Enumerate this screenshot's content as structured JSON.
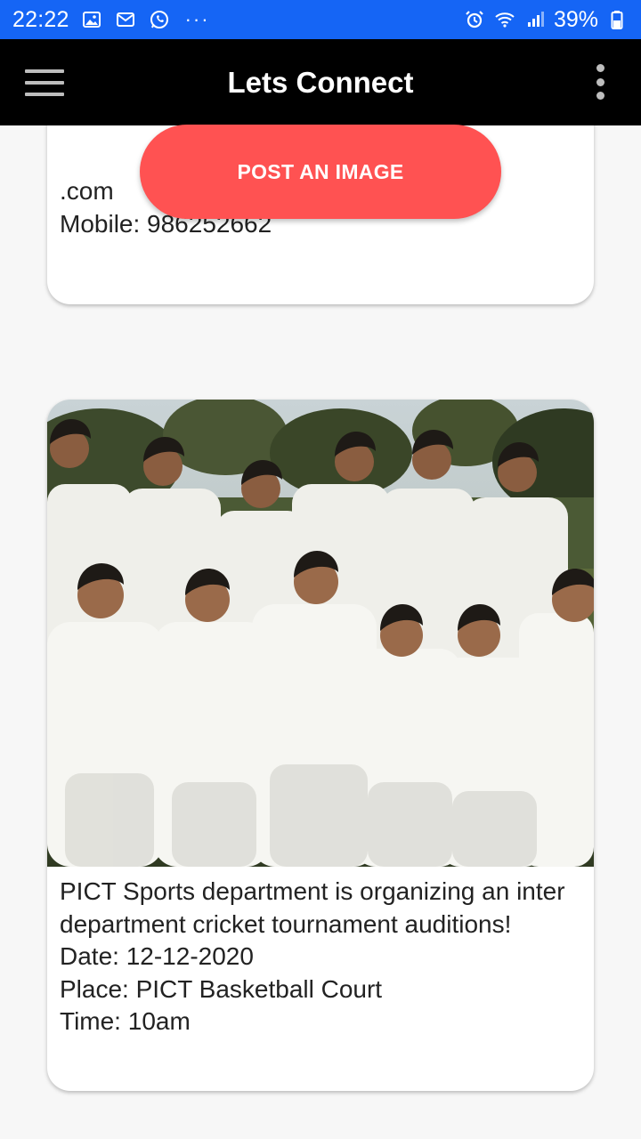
{
  "status_bar": {
    "time": "22:22",
    "battery": "39%",
    "more_indicator": "···",
    "icons": [
      "image-icon",
      "mail-icon",
      "whatsapp-icon",
      "alarm-icon",
      "wifi-icon",
      "signal-icon",
      "battery-icon"
    ]
  },
  "app_bar": {
    "title": "Lets Connect",
    "icons": [
      "hamburger-menu-icon",
      "overflow-menu-icon"
    ]
  },
  "post_button": {
    "label": "POST AN IMAGE",
    "color": "#ff5252"
  },
  "posts": [
    {
      "text": ".com\nMobile: 986252662"
    },
    {
      "image": "cricket-team-photo",
      "text": "PICT Sports department is organizing an inter department cricket tournament auditions!\nDate: 12-12-2020\nPlace: PICT Basketball Court\nTime: 10am"
    }
  ],
  "colors": {
    "status_bar": "#1565f5",
    "app_bar": "#000000",
    "background": "#f7f7f7",
    "accent": "#ff5252"
  }
}
